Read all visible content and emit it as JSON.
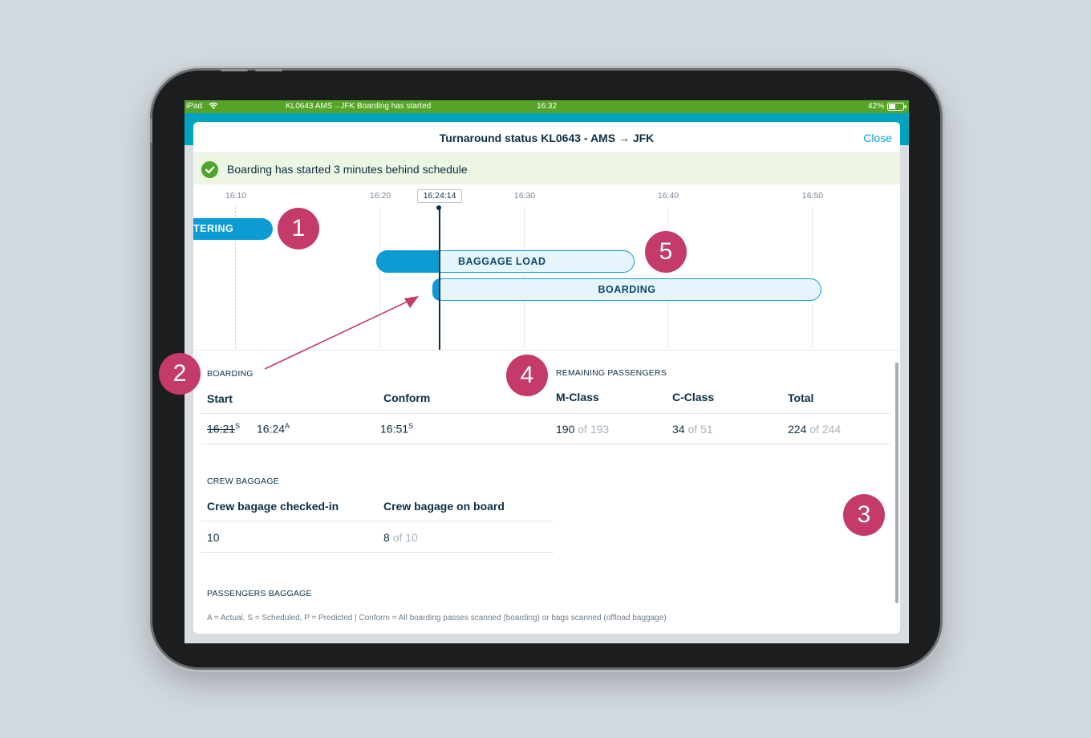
{
  "statusbar": {
    "device": "iPad",
    "flight_info": "KL0643  AMS→JFK  Boarding has started",
    "time": "16:32",
    "battery": "42%"
  },
  "modal": {
    "title": "Turnaround status KL0643 - AMS → JFK",
    "close_label": "Close"
  },
  "banner": {
    "text": "Boarding has started 3 minutes behind schedule",
    "icon": "check-circle-icon",
    "color": "#4ea52c"
  },
  "timeline": {
    "ticks": [
      "16:10",
      "16:20",
      "16:30",
      "16:40",
      "16:50"
    ],
    "current_time": "16:24:14",
    "bars": {
      "catering": "TERING",
      "baggage_load": "BAGGAGE LOAD",
      "boarding": "BOARDING"
    }
  },
  "boarding": {
    "section": "BOARDING",
    "start_header": "Start",
    "conform_header": "Conform",
    "scheduled_start": "16:21",
    "scheduled_start_tag": "S",
    "actual_start": "16:24",
    "actual_start_tag": "A",
    "conform": "16:51",
    "conform_tag": "S"
  },
  "remaining": {
    "section": "REMAINING PASSENGERS",
    "headers": [
      "M-Class",
      "C-Class",
      "Total"
    ],
    "m_class": {
      "value": "190",
      "of": "of 193"
    },
    "c_class": {
      "value": "34",
      "of": "of 51"
    },
    "total": {
      "value": "224",
      "of": "of 244"
    }
  },
  "crew_baggage": {
    "section": "CREW BAGGAGE",
    "headers": [
      "Crew bagage checked-in",
      "Crew bagage on board"
    ],
    "checked_in": "10",
    "on_board": {
      "value": "8",
      "of": "of 10"
    }
  },
  "passengers_baggage": {
    "section": "PASSENGERS BAGGAGE"
  },
  "footnote": "A = Actual, S = Scheduled, P = Predicted  |  Conform = All boarding passes scanned (boarding) or bags scanned (offload baggage)",
  "annotations": [
    "1",
    "2",
    "3",
    "4",
    "5"
  ],
  "colors": {
    "status_green": "#55a327",
    "accent_teal": "#00a3bd",
    "bar_blue": "#0d9bd6",
    "marker_pink": "#c43a6a"
  }
}
